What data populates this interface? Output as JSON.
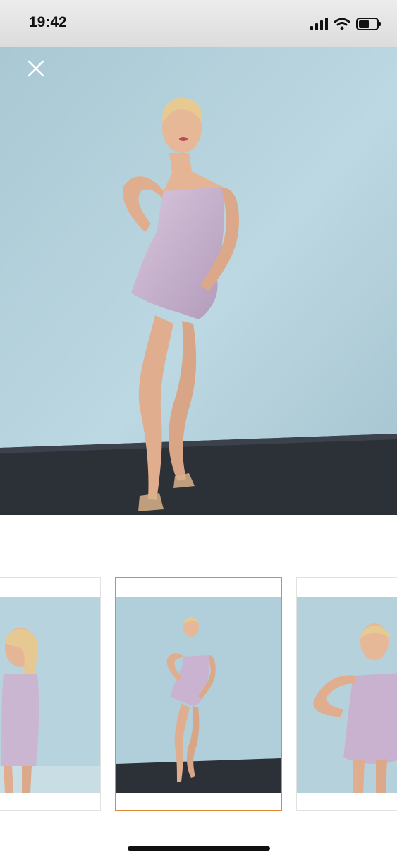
{
  "status_bar": {
    "time": "19:42",
    "icons": [
      "cellular-signal-icon",
      "wifi-icon",
      "battery-icon"
    ],
    "battery_level": 0.6
  },
  "viewer": {
    "close_icon": "close-icon",
    "main_image": "model-full-length-glitter-dress"
  },
  "thumbnails": [
    {
      "name": "thumbnail-back-view",
      "selected": false
    },
    {
      "name": "thumbnail-full-length",
      "selected": true
    },
    {
      "name": "thumbnail-front-closeup",
      "selected": false
    }
  ],
  "colors": {
    "background": "#ffffff",
    "wall": "#b4d1dc",
    "floor": "#2c3037",
    "dress": "#c8b3cf",
    "skin": "#e1b193",
    "hair": "#e6ca92",
    "selected_border": "#e08a35"
  }
}
